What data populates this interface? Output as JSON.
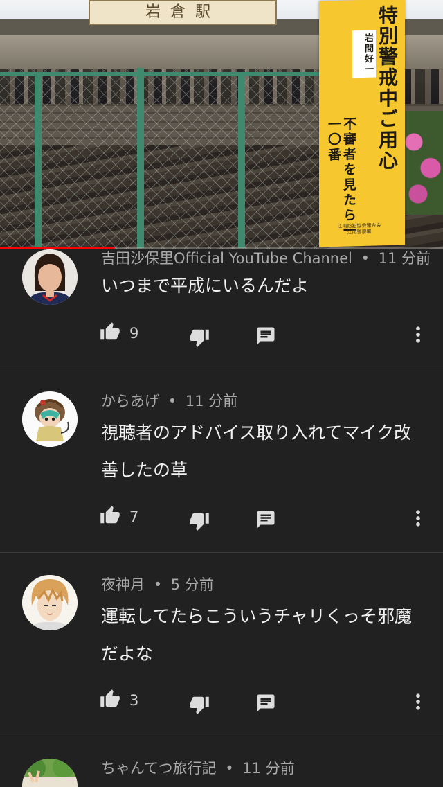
{
  "video": {
    "station_sign": "岩倉駅",
    "banner": {
      "main_text": "特別警戒中ご用心",
      "sub_text": "不審者を見たら一一〇番",
      "tag_text": "岩間好一",
      "footer_lines": [
        "江南防犯協会連合会",
        "江南警察署"
      ]
    },
    "progress_fraction": 0.26
  },
  "comments": [
    {
      "author": "吉田沙保里Official YouTube Channel",
      "time": "11 分前",
      "text": "いつまで平成にいるんだよ",
      "likes": "9",
      "avatar_icon": "person-photo-avatar"
    },
    {
      "author": "からあげ",
      "time": "11 分前",
      "text": "視聴者のアドバイス取り入れてマイク改善したの草",
      "likes": "7",
      "avatar_icon": "anime-character-avatar"
    },
    {
      "author": "夜神月",
      "time": "5 分前",
      "text": "運転してたらこういうチャリくっそ邪魔だよな",
      "likes": "3",
      "avatar_icon": "anime-boy-avatar"
    },
    {
      "author": "ちゃんてつ旅行記",
      "time": "11 分前",
      "text": "",
      "likes": "",
      "avatar_icon": "outdoor-photo-avatar"
    }
  ],
  "meta_separator": "•",
  "colors": {
    "background": "#212121",
    "progress": "#ff0000",
    "meta_text": "#a9a9a9",
    "body_text": "#f1f1f1"
  }
}
